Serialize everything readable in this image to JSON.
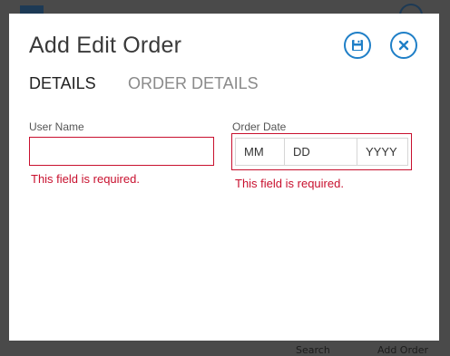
{
  "background": {
    "search_label": "Search",
    "add_order_label": "Add Order"
  },
  "dialog": {
    "title": "Add Edit Order",
    "save_icon": "save-icon",
    "close_icon": "close-icon",
    "accent_color": "#1f7fc7",
    "error_color": "#c8102e"
  },
  "tabs": [
    {
      "label": "DETAILS",
      "active": true
    },
    {
      "label": "ORDER DETAILS",
      "active": false
    }
  ],
  "form": {
    "user_name": {
      "label": "User Name",
      "value": "",
      "error": "This field is required."
    },
    "order_date": {
      "label": "Order Date",
      "month_placeholder": "MM",
      "day_placeholder": "DD",
      "year_placeholder": "YYYY",
      "error": "This field is required."
    }
  }
}
